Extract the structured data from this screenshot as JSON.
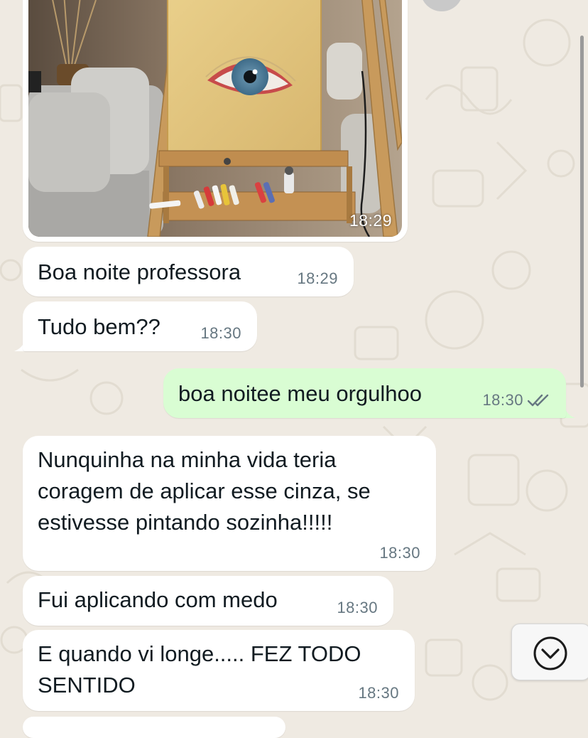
{
  "colors": {
    "background": "#efeae2",
    "incoming": "#ffffff",
    "outgoing": "#d9fdd3",
    "timestamp": "#667781",
    "read_ticks": "#667781"
  },
  "image_message": {
    "time": "18:29",
    "alt": "photo of an eye painting on a wooden easel"
  },
  "messages": [
    {
      "direction": "incoming",
      "text": "Boa noite professora",
      "time": "18:29"
    },
    {
      "direction": "incoming",
      "text": "Tudo bem??",
      "time": "18:30"
    },
    {
      "direction": "outgoing",
      "text": "boa noitee meu orgulhoo",
      "time": "18:30",
      "status_icon": "double-check-icon"
    },
    {
      "direction": "incoming",
      "text": "Nunquinha na minha vida teria\ncoragem de aplicar esse cinza, se\nestivesse pintando sozinha!!!!!",
      "time": "18:30"
    },
    {
      "direction": "incoming",
      "text": "Fui aplicando com medo",
      "time": "18:30"
    },
    {
      "direction": "incoming",
      "text": "E quando vi longe..... FEZ TODO\nSENTIDO",
      "time": "18:30"
    }
  ],
  "scroll_down_button": {
    "icon": "chevron-down-circle-icon"
  }
}
